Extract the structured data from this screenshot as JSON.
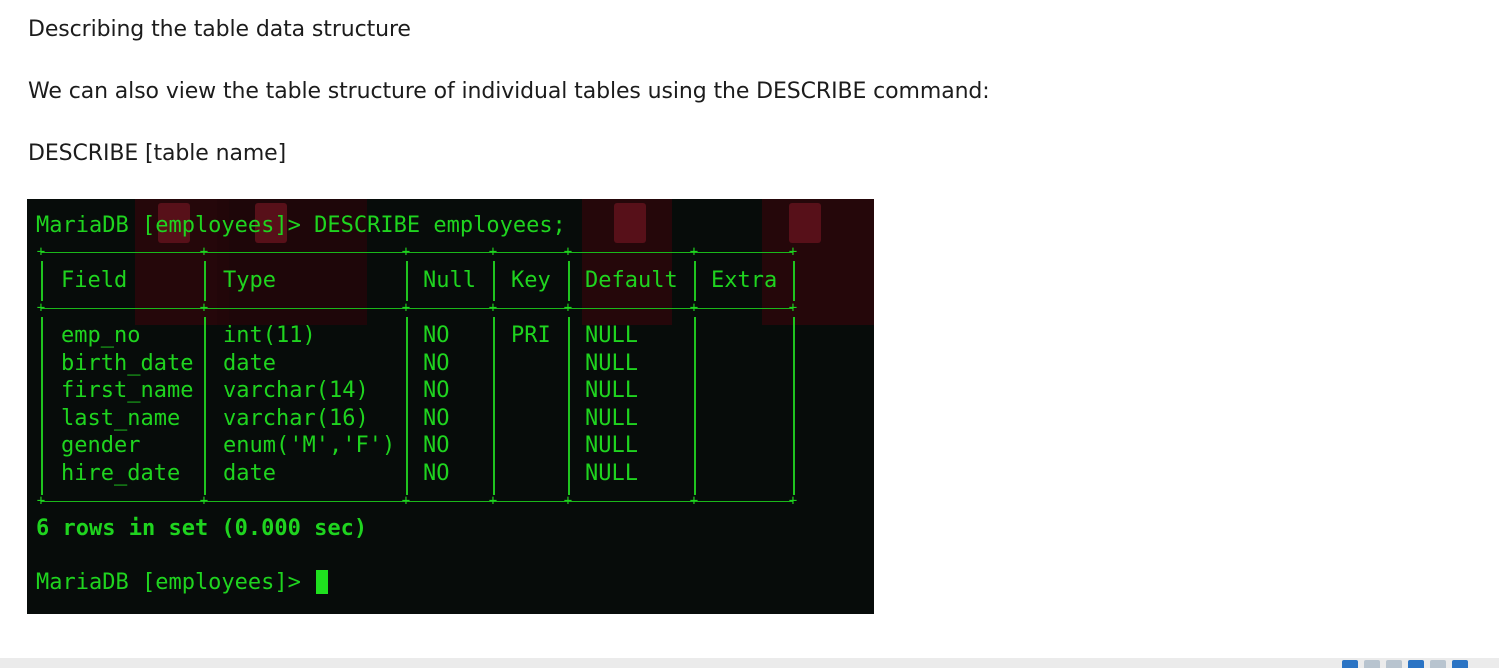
{
  "article": {
    "heading": "Describing the table data structure",
    "intro": "We can also view the table structure of individual tables using the DESCRIBE command:",
    "syntax": "DESCRIBE [table name]"
  },
  "terminal": {
    "command_line": "MariaDB [employees]> DESCRIBE employees;",
    "columns": [
      "Field",
      "Type",
      "Null",
      "Key",
      "Default",
      "Extra"
    ],
    "rows": [
      {
        "field": "emp_no",
        "type": "int(11)",
        "null": "NO",
        "key": "PRI",
        "default": "NULL",
        "extra": ""
      },
      {
        "field": "birth_date",
        "type": "date",
        "null": "NO",
        "key": "",
        "default": "NULL",
        "extra": ""
      },
      {
        "field": "first_name",
        "type": "varchar(14)",
        "null": "NO",
        "key": "",
        "default": "NULL",
        "extra": ""
      },
      {
        "field": "last_name",
        "type": "varchar(16)",
        "null": "NO",
        "key": "",
        "default": "NULL",
        "extra": ""
      },
      {
        "field": "gender",
        "type": "enum('M','F')",
        "null": "NO",
        "key": "",
        "default": "NULL",
        "extra": ""
      },
      {
        "field": "hire_date",
        "type": "date",
        "null": "NO",
        "key": "",
        "default": "NULL",
        "extra": ""
      }
    ],
    "result_line": "6 rows in set (0.000 sec)",
    "prompt": "MariaDB [employees]> ",
    "colors": {
      "background": "#070c0a",
      "text": "#1fd41f"
    }
  },
  "taskbar_icons": [
    "network-icon",
    "disk-icon",
    "display-icon",
    "usb-icon",
    "audio-icon",
    "window-icon"
  ]
}
